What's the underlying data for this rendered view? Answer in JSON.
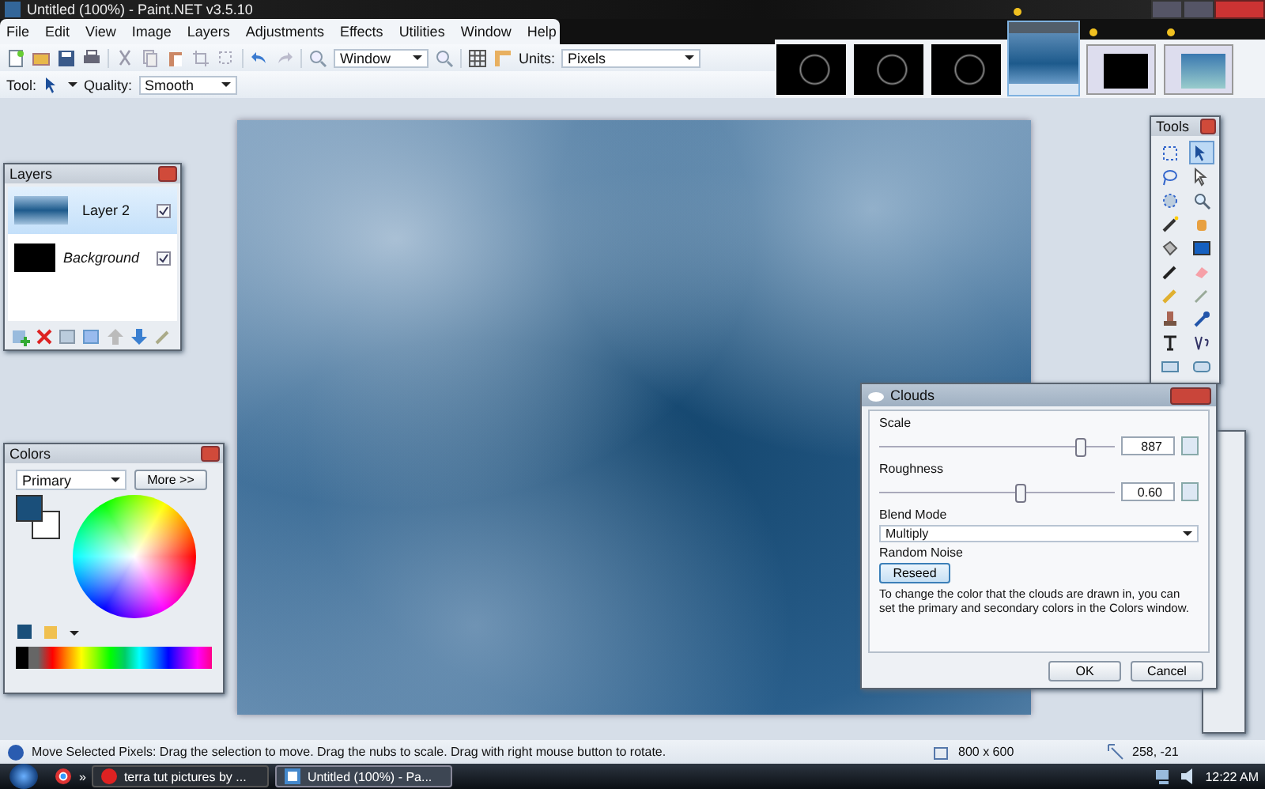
{
  "window": {
    "title": "Untitled (100%) - Paint.NET v3.5.10"
  },
  "menu": [
    "File",
    "Edit",
    "View",
    "Image",
    "Layers",
    "Adjustments",
    "Effects",
    "Utilities",
    "Window",
    "Help"
  ],
  "toolbar": {
    "zoom": "Window",
    "units_label": "Units:",
    "units": "Pixels",
    "tool_label": "Tool:",
    "quality_label": "Quality:",
    "quality": "Smooth"
  },
  "image_tabs": [
    {
      "kind": "rings",
      "selected": false,
      "modified": false
    },
    {
      "kind": "rings",
      "selected": false,
      "modified": false
    },
    {
      "kind": "rings",
      "selected": false,
      "modified": false
    },
    {
      "kind": "gradient",
      "selected": true,
      "modified": true
    },
    {
      "kind": "window-dark",
      "selected": false,
      "modified": true
    },
    {
      "kind": "window-blue",
      "selected": false,
      "modified": true
    }
  ],
  "layers": {
    "title": "Layers",
    "items": [
      {
        "name": "Layer 2",
        "kind": "layer",
        "selected": true,
        "visible": true
      },
      {
        "name": "Background",
        "kind": "background",
        "selected": false,
        "visible": true
      }
    ]
  },
  "colors": {
    "title": "Colors",
    "mode": "Primary",
    "more_button": "More >>"
  },
  "tools": {
    "title": "Tools",
    "items": [
      {
        "kind": "rect-select",
        "selected": false
      },
      {
        "kind": "move-pixels",
        "selected": true
      },
      {
        "kind": "lasso",
        "selected": false
      },
      {
        "kind": "move-selection",
        "selected": false
      },
      {
        "kind": "ellipse-select",
        "selected": false
      },
      {
        "kind": "zoom",
        "selected": false
      },
      {
        "kind": "magic-wand",
        "selected": false
      },
      {
        "kind": "pan",
        "selected": false
      },
      {
        "kind": "bucket",
        "selected": false
      },
      {
        "kind": "gradient",
        "selected": false
      },
      {
        "kind": "brush",
        "selected": false
      },
      {
        "kind": "eraser",
        "selected": false
      },
      {
        "kind": "pencil",
        "selected": false
      },
      {
        "kind": "picker",
        "selected": false
      },
      {
        "kind": "stamp",
        "selected": false
      },
      {
        "kind": "recolor",
        "selected": false
      },
      {
        "kind": "text",
        "selected": false
      },
      {
        "kind": "line",
        "selected": false
      },
      {
        "kind": "rectangle",
        "selected": false
      },
      {
        "kind": "rounded-rectangle",
        "selected": false
      }
    ]
  },
  "clouds": {
    "title": "Clouds",
    "sliders": [
      {
        "label": "Scale",
        "level": 0.85,
        "value": "887"
      },
      {
        "label": "Roughness",
        "level": 0.6,
        "value": "0.60"
      }
    ],
    "blend_label": "Blend Mode",
    "blend_mode": "Multiply",
    "noise_label": "Random Noise",
    "reseed_button": "Reseed",
    "hint": "To change the color that the clouds are drawn in, you can set the primary and secondary colors in the Colors window.",
    "buttons": [
      "OK",
      "Cancel"
    ]
  },
  "status_bar": {
    "text": "Move Selected Pixels: Drag the selection to move. Drag the nubs to scale. Drag with right mouse button to rotate.",
    "size": "800 x 600",
    "position": "258, -21"
  },
  "taskbar": {
    "overflow": "»",
    "tasks": [
      {
        "label": "terra tut pictures by ...",
        "kind": "browser",
        "selected": false
      },
      {
        "label": "Untitled (100%) - Pa...",
        "kind": "paint",
        "selected": true
      }
    ],
    "clock": "12:22 AM"
  }
}
